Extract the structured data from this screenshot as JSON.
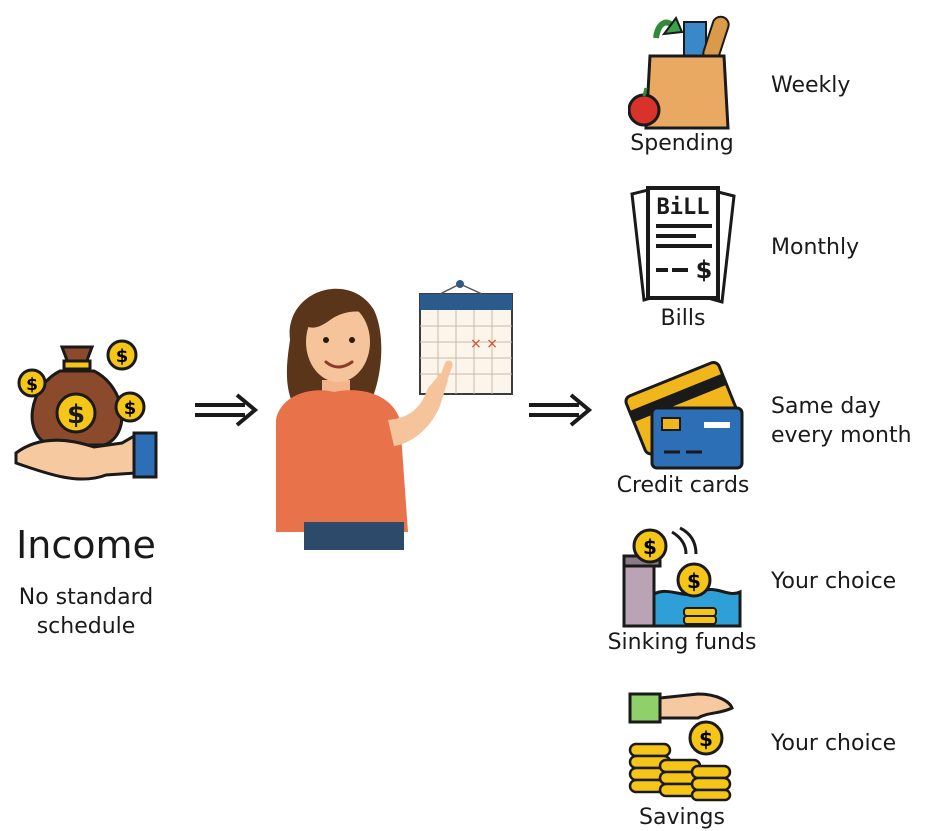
{
  "income": {
    "title": "Income",
    "subtitle_line1": "No standard",
    "subtitle_line2": "schedule"
  },
  "categories": [
    {
      "label": "Spending",
      "frequency": "Weekly",
      "icon": "grocery-bag-icon"
    },
    {
      "label": "Bills",
      "frequency": "Monthly",
      "icon": "bill-icon"
    },
    {
      "label": "Credit cards",
      "frequency_line1": "Same day",
      "frequency_line2": "every month",
      "icon": "credit-card-icon"
    },
    {
      "label": "Sinking funds",
      "frequency": "Your choice",
      "icon": "sinking-fund-icon"
    },
    {
      "label": "Savings",
      "frequency": "Your choice",
      "icon": "savings-coins-icon"
    }
  ],
  "calendar_marks": "× ×",
  "colors": {
    "coin": "#f5c518",
    "money_bag": "#8b4a2b",
    "shirt": "#e8734a",
    "card_yellow": "#f2b61d",
    "card_blue": "#2c6fb7",
    "calendar_header": "#2b5a8c"
  }
}
